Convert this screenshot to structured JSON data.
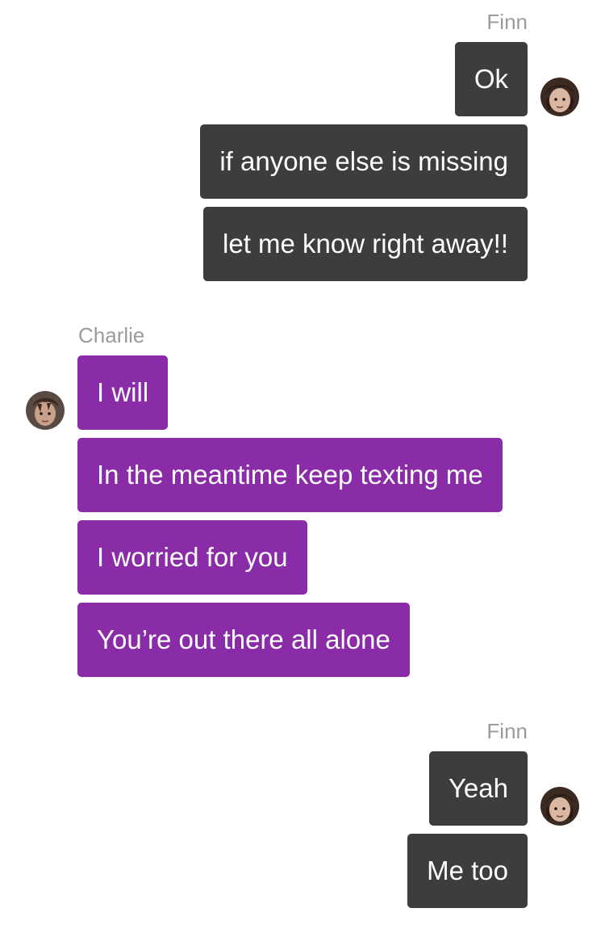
{
  "conversation": {
    "groups": [
      {
        "sender": "Finn",
        "side": "right",
        "avatar_icon": "finn-avatar-icon",
        "messages": [
          "Ok",
          "if anyone else is missing",
          "let me know right away!!"
        ]
      },
      {
        "sender": "Charlie",
        "side": "left",
        "avatar_icon": "charlie-avatar-icon",
        "messages": [
          "I will",
          "In the meantime keep texting me",
          "I worried for you",
          "You’re out there all alone"
        ]
      },
      {
        "sender": "Finn",
        "side": "right",
        "avatar_icon": "finn-avatar-icon",
        "messages": [
          "Yeah",
          "Me too"
        ]
      }
    ]
  },
  "colors": {
    "outgoing_bubble": "#3d3d3d",
    "incoming_bubble": "#8a2ba8",
    "sender_name": "#9b9b9b",
    "bubble_text": "#ffffff",
    "background": "#ffffff"
  }
}
